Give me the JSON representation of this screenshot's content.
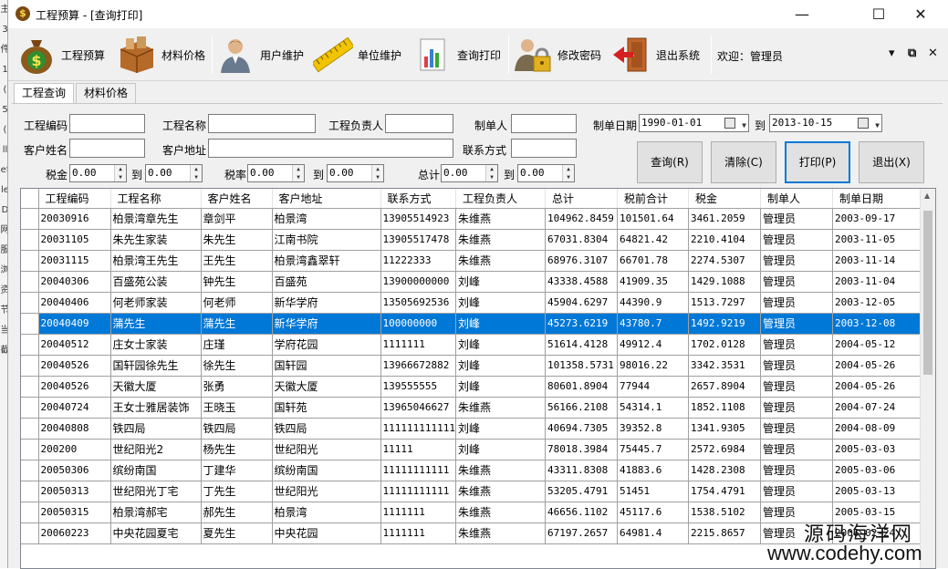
{
  "window": {
    "title": "工程预算 - [查询打印]",
    "minimize": "—",
    "maximize": "☐",
    "close": "✕"
  },
  "toolbar": {
    "items": [
      {
        "label": "工程预算",
        "icon": "money-bag-icon"
      },
      {
        "label": "材料价格",
        "icon": "materials-box-icon"
      },
      {
        "label": "用户维护",
        "icon": "user-icon"
      },
      {
        "label": "单位维护",
        "icon": "ruler-icon"
      },
      {
        "label": "查询打印",
        "icon": "bar-chart-icon"
      },
      {
        "label": "修改密码",
        "icon": "user-lock-icon"
      },
      {
        "label": "退出系统",
        "icon": "exit-door-icon"
      }
    ],
    "welcome": "欢迎：管理员",
    "mdi_minimize": "▾",
    "mdi_restore": "⧉",
    "mdi_close": "✕"
  },
  "tabs": [
    {
      "label": "工程查询",
      "active": true
    },
    {
      "label": "材料价格",
      "active": false
    }
  ],
  "filters": {
    "project_code_label": "工程编码",
    "project_name_label": "工程名称",
    "manager_label": "工程负责人",
    "creator_label": "制单人",
    "date_label": "制单日期",
    "date_from": "1990-01-01",
    "date_to_label": "到",
    "date_to": "2013-10-15",
    "customer_name_label": "客户姓名",
    "customer_address_label": "客户地址",
    "contact_label": "联系方式",
    "tax_label": "税金",
    "tax_from": "0.00",
    "tax_to_label": "到",
    "tax_to": "0.00",
    "taxrate_label": "税率",
    "taxrate_from": "0.00",
    "taxrate_to_label": "到",
    "taxrate_to": "0.00",
    "total_label": "总计",
    "total_from": "0.00",
    "total_to_label": "到",
    "total_to": "0.00"
  },
  "buttons": {
    "query": "查询(R)",
    "clear": "清除(C)",
    "print": "打印(P)",
    "exit": "退出(X)"
  },
  "grid": {
    "columns": [
      "工程编码",
      "工程名称",
      "客户姓名",
      "客户地址",
      "联系方式",
      "工程负责人",
      "总计",
      "税前合计",
      "税金",
      "制单人",
      "制单日期"
    ],
    "rows": [
      [
        "20030916",
        "柏景湾章先生",
        "章剑平",
        "柏景湾",
        "13905514923",
        "朱维燕",
        "104962.8459",
        "101501.64",
        "3461.2059",
        "管理员",
        "2003-09-17"
      ],
      [
        "20031105",
        "朱先生家装",
        "朱先生",
        "江南书院",
        "13905517478",
        "朱维燕",
        "67031.8304",
        "64821.42",
        "2210.4104",
        "管理员",
        "2003-11-05"
      ],
      [
        "20031115",
        "柏景湾王先生",
        "王先生",
        "柏景湾鑫翠轩",
        "11222333",
        "朱维燕",
        "68976.3107",
        "66701.78",
        "2274.5307",
        "管理员",
        "2003-11-14"
      ],
      [
        "20040306",
        "百盛苑公装",
        "钟先生",
        "百盛苑",
        "13900000000",
        "刘峰",
        "43338.4588",
        "41909.35",
        "1429.1088",
        "管理员",
        "2003-11-04"
      ],
      [
        "20040406",
        "何老师家装",
        "何老师",
        "新华学府",
        "13505692536",
        "刘峰",
        "45904.6297",
        "44390.9",
        "1513.7297",
        "管理员",
        "2003-12-05"
      ],
      [
        "20040409",
        "蒲先生",
        "蒲先生",
        "新华学府",
        "100000000",
        "刘峰",
        "45273.6219",
        "43780.7",
        "1492.9219",
        "管理员",
        "2003-12-08"
      ],
      [
        "20040512",
        "庄女士家装",
        "庄瑾",
        "学府花园",
        "1111111",
        "刘峰",
        "51614.4128",
        "49912.4",
        "1702.0128",
        "管理员",
        "2004-05-12"
      ],
      [
        "20040526",
        "国轩园徐先生",
        "徐先生",
        "国轩园",
        "13966672882",
        "刘峰",
        "101358.5731",
        "98016.22",
        "3342.3531",
        "管理员",
        "2004-05-26"
      ],
      [
        "20040526",
        "天徽大厦",
        "张勇",
        "天徽大厦",
        "139555555",
        "刘峰",
        "80601.8904",
        "77944",
        "2657.8904",
        "管理员",
        "2004-05-26"
      ],
      [
        "20040724",
        "王女士雅居装饰",
        "王晓玉",
        "国轩苑",
        "13965046627",
        "朱维燕",
        "56166.2108",
        "54314.1",
        "1852.1108",
        "管理员",
        "2004-07-24"
      ],
      [
        "20040808",
        "铁四局",
        "铁四局",
        "铁四局",
        "111111111111",
        "刘峰",
        "40694.7305",
        "39352.8",
        "1341.9305",
        "管理员",
        "2004-08-09"
      ],
      [
        "200200",
        "世纪阳光2",
        "杨先生",
        "世纪阳光",
        "11111",
        "刘峰",
        "78018.3984",
        "75445.7",
        "2572.6984",
        "管理员",
        "2005-03-03"
      ],
      [
        "20050306",
        "缤纷南国",
        "丁建华",
        "缤纷南国",
        "11111111111",
        "朱维燕",
        "43311.8308",
        "41883.6",
        "1428.2308",
        "管理员",
        "2005-03-06"
      ],
      [
        "20050313",
        "世纪阳光丁宅",
        "丁先生",
        "世纪阳光",
        "11111111111",
        "朱维燕",
        "53205.4791",
        "51451",
        "1754.4791",
        "管理员",
        "2005-03-13"
      ],
      [
        "20050315",
        "柏景湾郝宅",
        "郝先生",
        "柏景湾",
        "1111111",
        "朱维燕",
        "46656.1102",
        "45117.6",
        "1538.5102",
        "管理员",
        "2005-03-15"
      ],
      [
        "20060223",
        "中央花园夏宅",
        "夏先生",
        "中央花园",
        "1111111",
        "朱维燕",
        "67197.2657",
        "64981.4",
        "2215.8657",
        "管理员",
        "2006-02-24"
      ]
    ],
    "selected_row": 5
  },
  "watermark": {
    "line1": "源码海洋网",
    "line2": "www.codehy.com"
  },
  "desktop_strip": [
    "主",
    "3",
    "件",
    "1",
    "(",
    "5",
    "(",
    "ll",
    "ef",
    "le",
    "D",
    "网",
    "服",
    "浏",
    "资",
    "节",
    "当",
    "截"
  ]
}
